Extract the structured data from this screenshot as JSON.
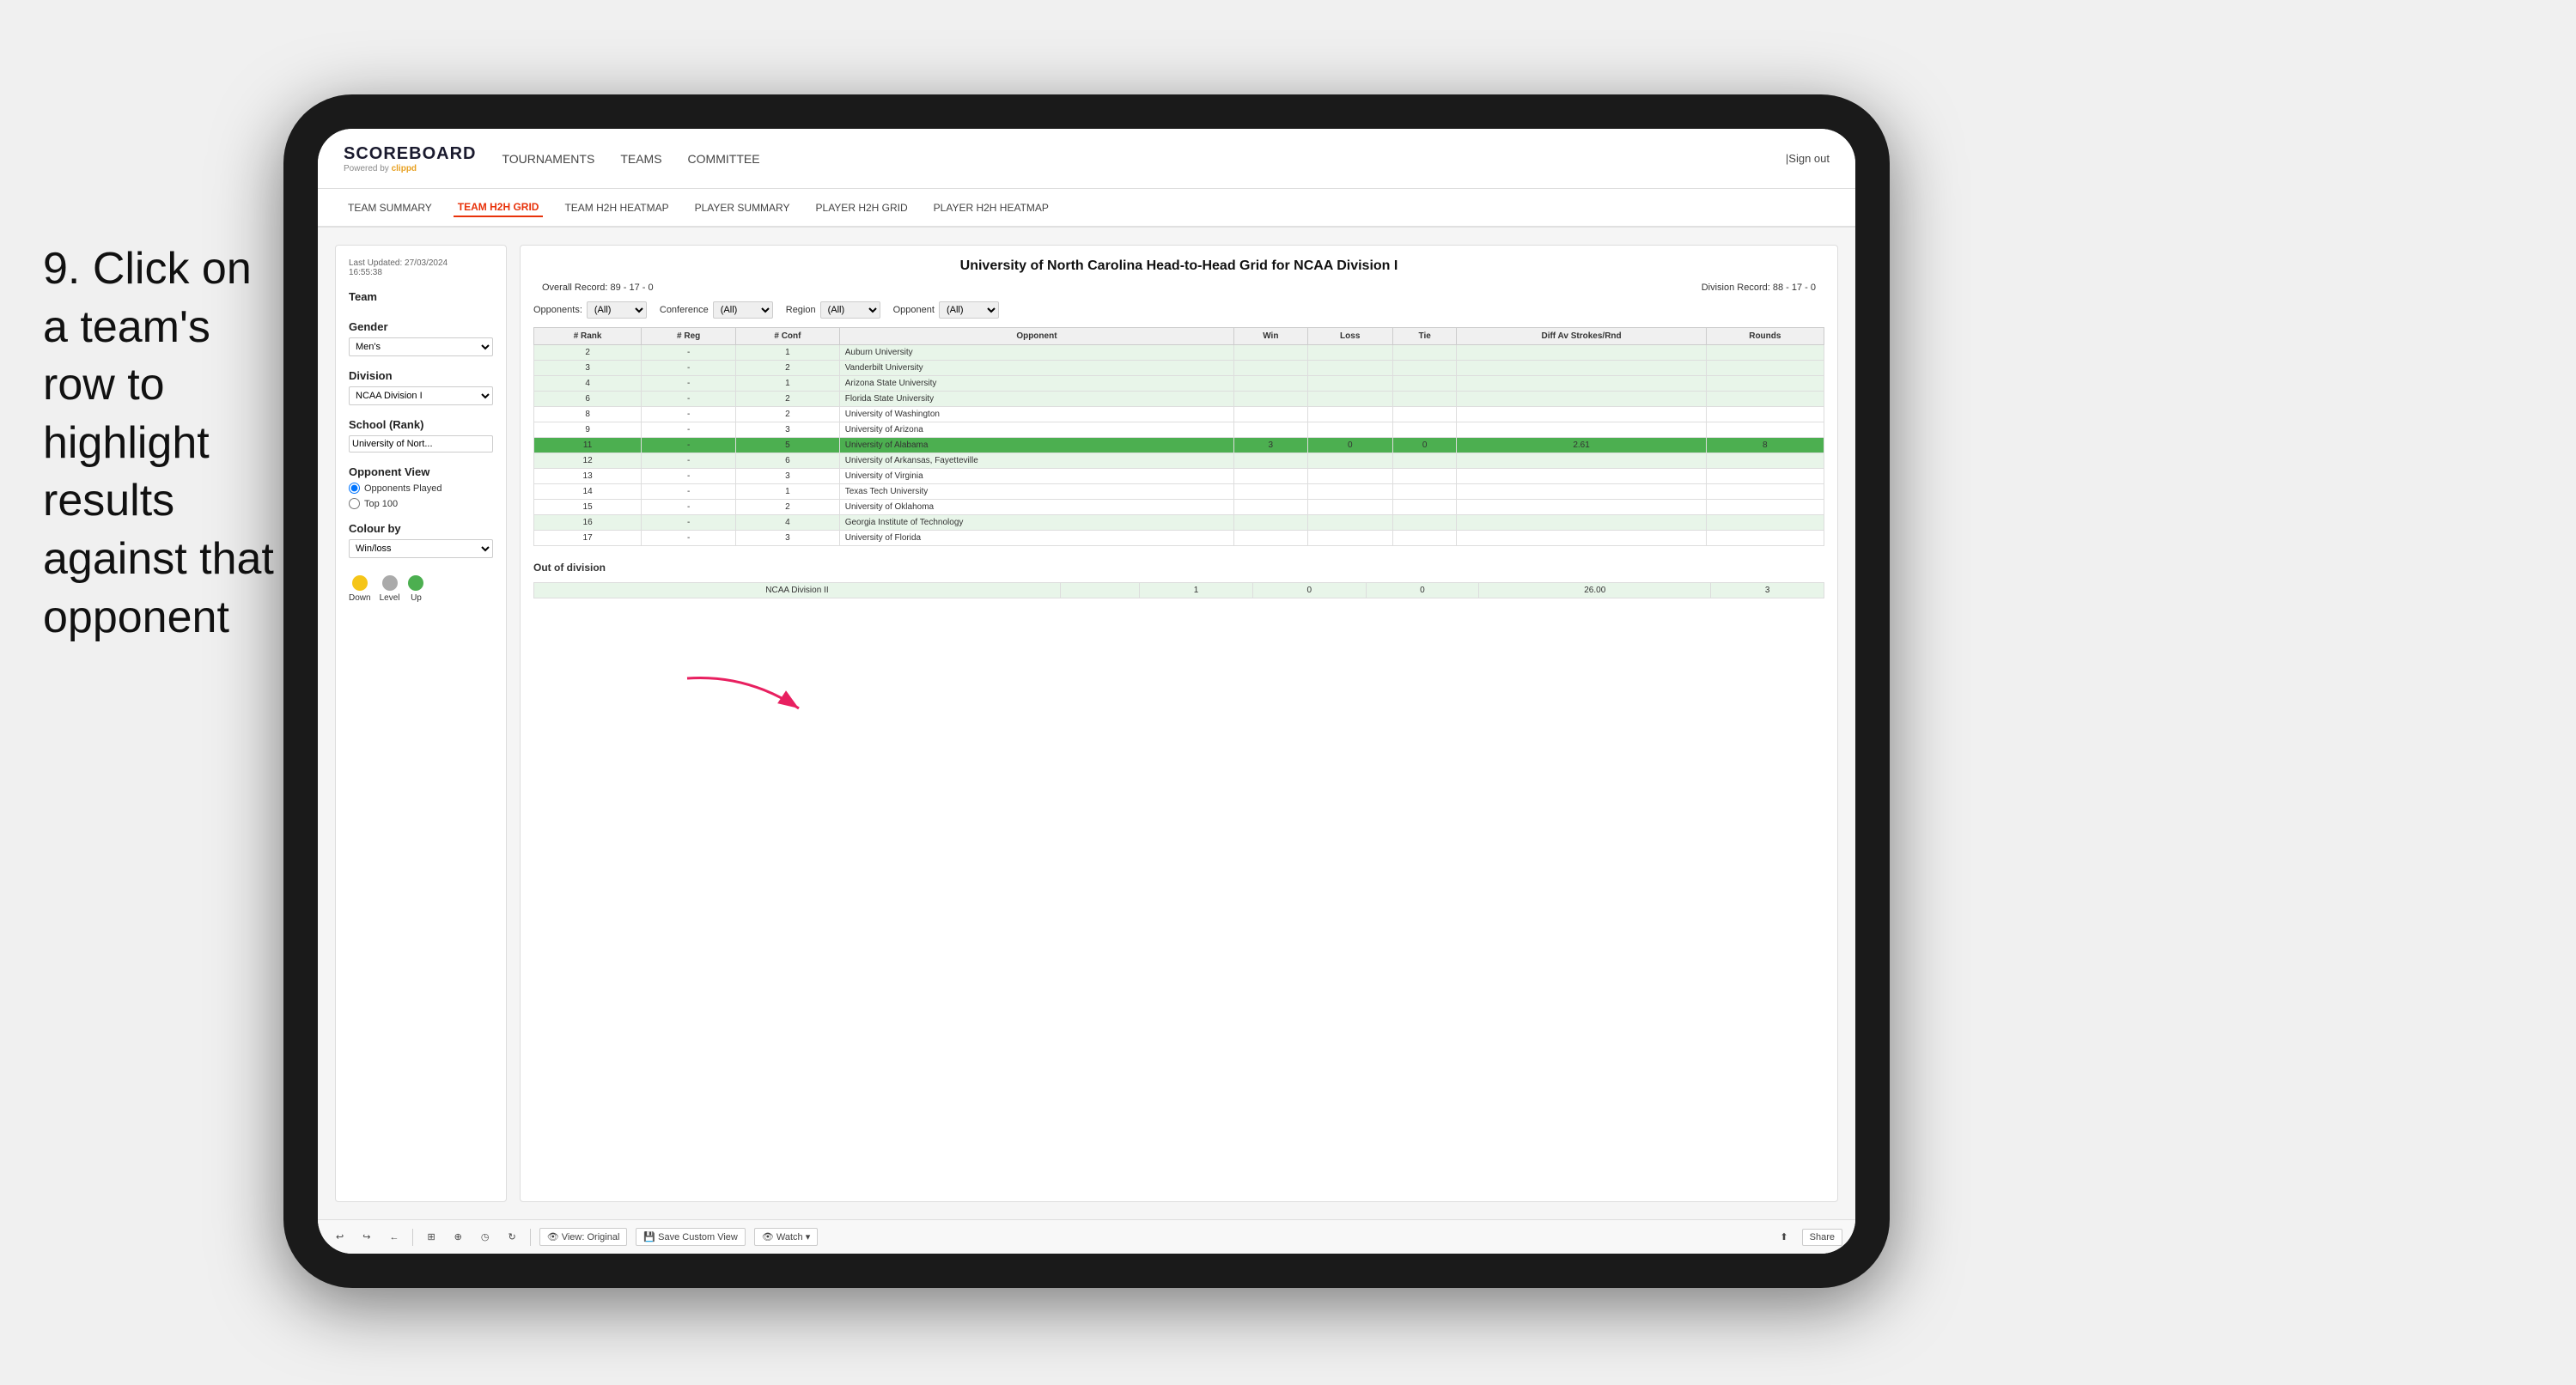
{
  "instruction": {
    "step": "9.",
    "text": "Click on a team's row to highlight results against that opponent"
  },
  "app": {
    "logo": "SCOREBOARD",
    "powered_by": "Powered by clippd",
    "sign_out_separator": "|",
    "sign_out": "Sign out"
  },
  "main_nav": {
    "items": [
      {
        "label": "TOURNAMENTS",
        "active": false
      },
      {
        "label": "TEAMS",
        "active": false
      },
      {
        "label": "COMMITTEE",
        "active": false
      }
    ]
  },
  "sub_nav": {
    "items": [
      {
        "label": "TEAM SUMMARY",
        "active": false
      },
      {
        "label": "TEAM H2H GRID",
        "active": true
      },
      {
        "label": "TEAM H2H HEATMAP",
        "active": false
      },
      {
        "label": "PLAYER SUMMARY",
        "active": false
      },
      {
        "label": "PLAYER H2H GRID",
        "active": false
      },
      {
        "label": "PLAYER H2H HEATMAP",
        "active": false
      }
    ]
  },
  "sidebar": {
    "last_updated_label": "Last Updated: 27/03/2024",
    "last_updated_time": "16:55:38",
    "team_label": "Team",
    "gender_label": "Gender",
    "gender_value": "Men's",
    "division_label": "Division",
    "division_value": "NCAA Division I",
    "school_label": "School (Rank)",
    "school_value": "University of Nort...",
    "opponent_view_label": "Opponent View",
    "radio_opponents": "Opponents Played",
    "radio_top100": "Top 100",
    "colour_by_label": "Colour by",
    "colour_by_value": "Win/loss",
    "legend": {
      "down_label": "Down",
      "level_label": "Level",
      "up_label": "Up",
      "down_color": "#f5c518",
      "level_color": "#aaaaaa",
      "up_color": "#4caf50"
    }
  },
  "grid": {
    "title": "University of North Carolina Head-to-Head Grid for NCAA Division I",
    "overall_record_label": "Overall Record:",
    "overall_record": "89 - 17 - 0",
    "division_record_label": "Division Record:",
    "division_record": "88 - 17 - 0",
    "filters": {
      "opponents_label": "Opponents:",
      "opponents_value": "(All)",
      "conference_label": "Conference",
      "conference_value": "(All)",
      "region_label": "Region",
      "region_value": "(All)",
      "opponent_label": "Opponent",
      "opponent_value": "(All)"
    },
    "table_headers": [
      "# Rank",
      "# Reg",
      "# Conf",
      "Opponent",
      "Win",
      "Loss",
      "Tie",
      "Diff Av Strokes/Rnd",
      "Rounds"
    ],
    "rows": [
      {
        "rank": "2",
        "reg": "-",
        "conf": "1",
        "opponent": "Auburn University",
        "win": "",
        "loss": "",
        "tie": "",
        "diff": "",
        "rounds": "",
        "style": "light-green"
      },
      {
        "rank": "3",
        "reg": "-",
        "conf": "2",
        "opponent": "Vanderbilt University",
        "win": "",
        "loss": "",
        "tie": "",
        "diff": "",
        "rounds": "",
        "style": "light-green"
      },
      {
        "rank": "4",
        "reg": "-",
        "conf": "1",
        "opponent": "Arizona State University",
        "win": "",
        "loss": "",
        "tie": "",
        "diff": "",
        "rounds": "",
        "style": "light-green"
      },
      {
        "rank": "6",
        "reg": "-",
        "conf": "2",
        "opponent": "Florida State University",
        "win": "",
        "loss": "",
        "tie": "",
        "diff": "",
        "rounds": "",
        "style": "light-green"
      },
      {
        "rank": "8",
        "reg": "-",
        "conf": "2",
        "opponent": "University of Washington",
        "win": "",
        "loss": "",
        "tie": "",
        "diff": "",
        "rounds": "",
        "style": "normal"
      },
      {
        "rank": "9",
        "reg": "-",
        "conf": "3",
        "opponent": "University of Arizona",
        "win": "",
        "loss": "",
        "tie": "",
        "diff": "",
        "rounds": "",
        "style": "normal"
      },
      {
        "rank": "11",
        "reg": "-",
        "conf": "5",
        "opponent": "University of Alabama",
        "win": "3",
        "loss": "0",
        "tie": "0",
        "diff": "2.61",
        "rounds": "8",
        "style": "highlighted"
      },
      {
        "rank": "12",
        "reg": "-",
        "conf": "6",
        "opponent": "University of Arkansas, Fayetteville",
        "win": "",
        "loss": "",
        "tie": "",
        "diff": "",
        "rounds": "",
        "style": "light-green"
      },
      {
        "rank": "13",
        "reg": "-",
        "conf": "3",
        "opponent": "University of Virginia",
        "win": "",
        "loss": "",
        "tie": "",
        "diff": "",
        "rounds": "",
        "style": "normal"
      },
      {
        "rank": "14",
        "reg": "-",
        "conf": "1",
        "opponent": "Texas Tech University",
        "win": "",
        "loss": "",
        "tie": "",
        "diff": "",
        "rounds": "",
        "style": "normal"
      },
      {
        "rank": "15",
        "reg": "-",
        "conf": "2",
        "opponent": "University of Oklahoma",
        "win": "",
        "loss": "",
        "tie": "",
        "diff": "",
        "rounds": "",
        "style": "normal"
      },
      {
        "rank": "16",
        "reg": "-",
        "conf": "4",
        "opponent": "Georgia Institute of Technology",
        "win": "",
        "loss": "",
        "tie": "",
        "diff": "",
        "rounds": "",
        "style": "light-green"
      },
      {
        "rank": "17",
        "reg": "-",
        "conf": "3",
        "opponent": "University of Florida",
        "win": "",
        "loss": "",
        "tie": "",
        "diff": "",
        "rounds": "",
        "style": "normal"
      }
    ],
    "out_of_division_label": "Out of division",
    "out_of_division_rows": [
      {
        "division": "NCAA Division II",
        "win": "1",
        "loss": "0",
        "tie": "0",
        "diff": "26.00",
        "rounds": "3",
        "style": "out-div"
      }
    ]
  },
  "bottom_toolbar": {
    "undo": "↩",
    "redo": "↪",
    "back": "←",
    "icons": [
      "⊞",
      "⊕",
      "◷",
      "↻"
    ],
    "view_original": "View: Original",
    "save_custom": "Save Custom View",
    "watch": "Watch ▾",
    "share": "Share"
  }
}
